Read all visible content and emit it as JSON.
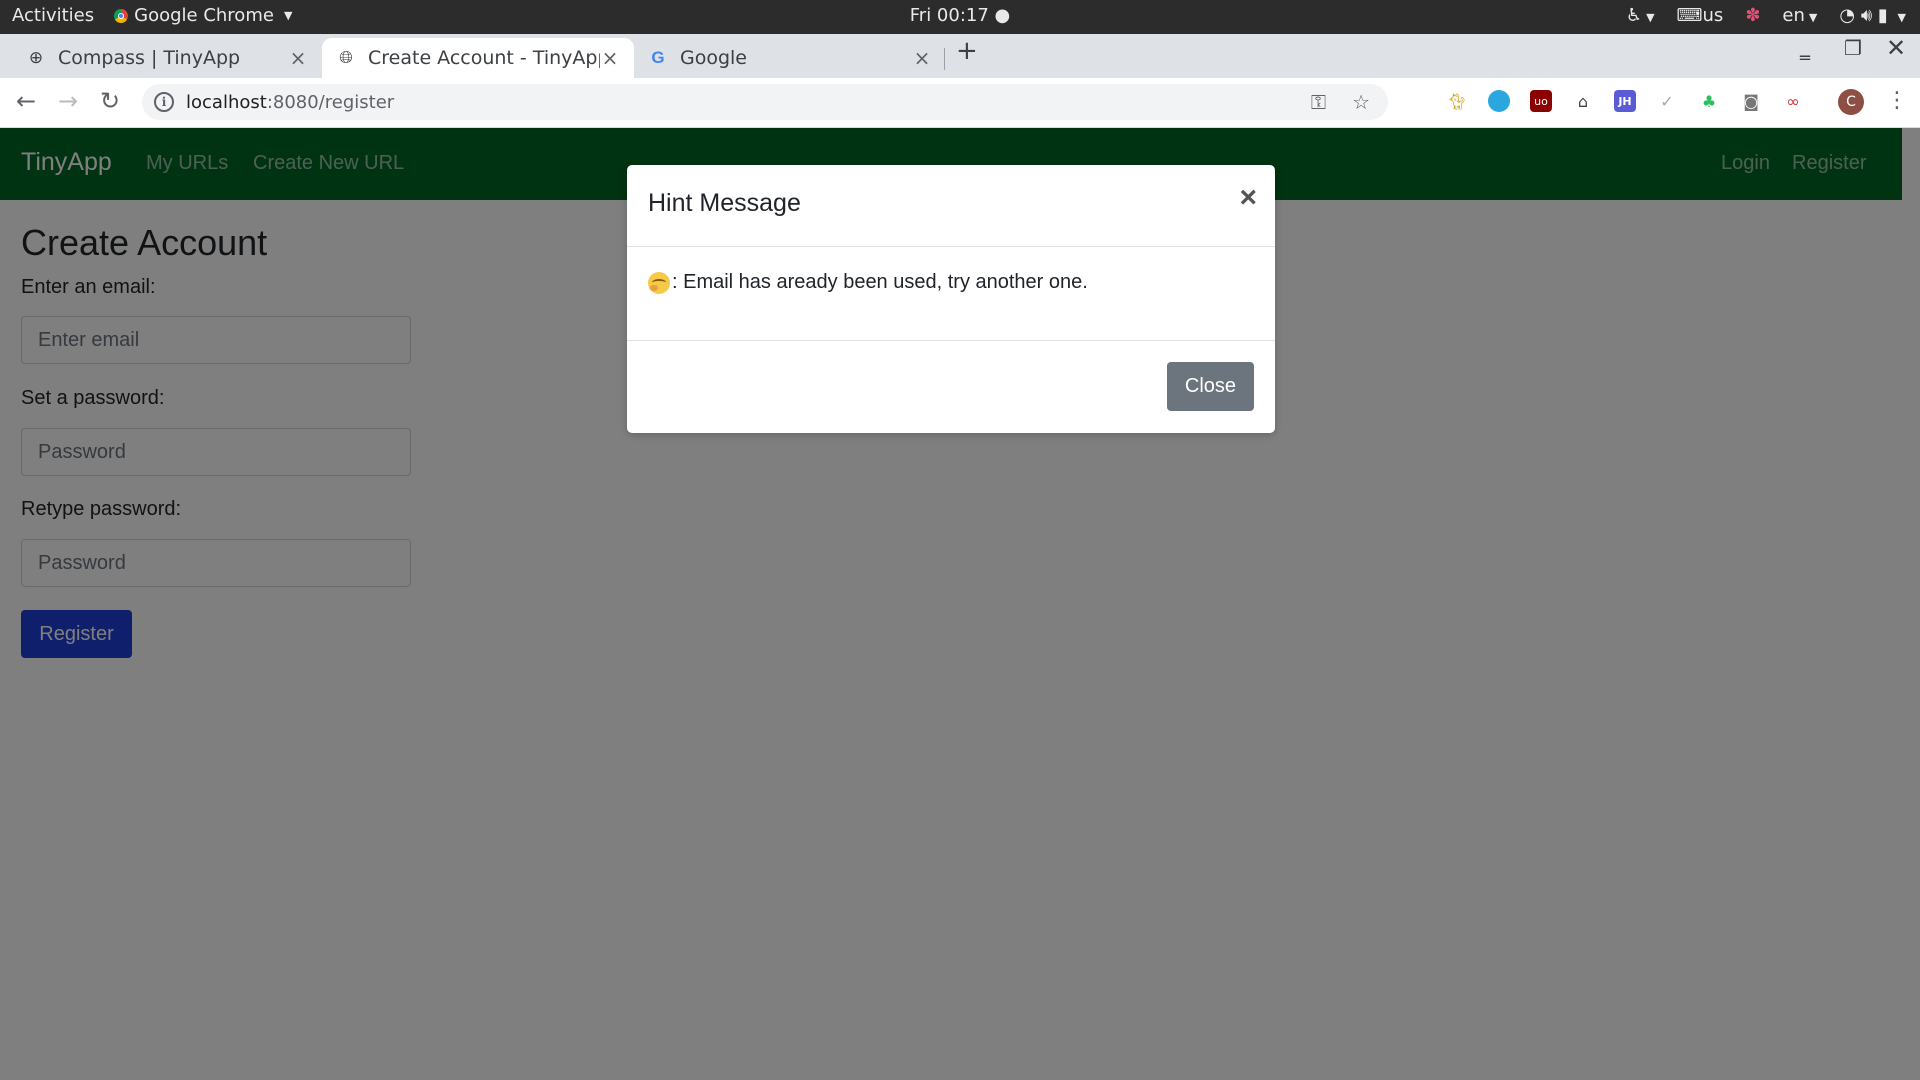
{
  "system_bar": {
    "activities": "Activities",
    "app_name": "Google Chrome",
    "clock": "Fri 00:17 ●",
    "keyboard": "us",
    "language": "en"
  },
  "tabs": [
    {
      "title": "Compass | TinyApp",
      "icon": "compass-icon"
    },
    {
      "title": "Create Account - TinyApp",
      "icon": "globe-icon",
      "active": true
    },
    {
      "title": "Google",
      "icon": "google-icon"
    }
  ],
  "address_bar": {
    "host": "localhost",
    "rest": ":8080/register"
  },
  "profile_initial": "C",
  "app": {
    "brand": "TinyApp",
    "nav_left": [
      "My URLs",
      "Create New URL"
    ],
    "nav_right": [
      "Login",
      "Register"
    ],
    "nav_color": "#006622"
  },
  "form": {
    "title": "Create Account",
    "email_label": "Enter an email:",
    "email_placeholder": "Enter email",
    "password_label": "Set a password:",
    "password_placeholder": "Password",
    "retype_label": "Retype password:",
    "retype_placeholder": "Password",
    "submit_label": "Register",
    "submit_color": "#1f3fd6"
  },
  "modal": {
    "title": "Hint Message",
    "close_x": "×",
    "message": ": Email has aready been used, try another one.",
    "close_label": "Close"
  }
}
